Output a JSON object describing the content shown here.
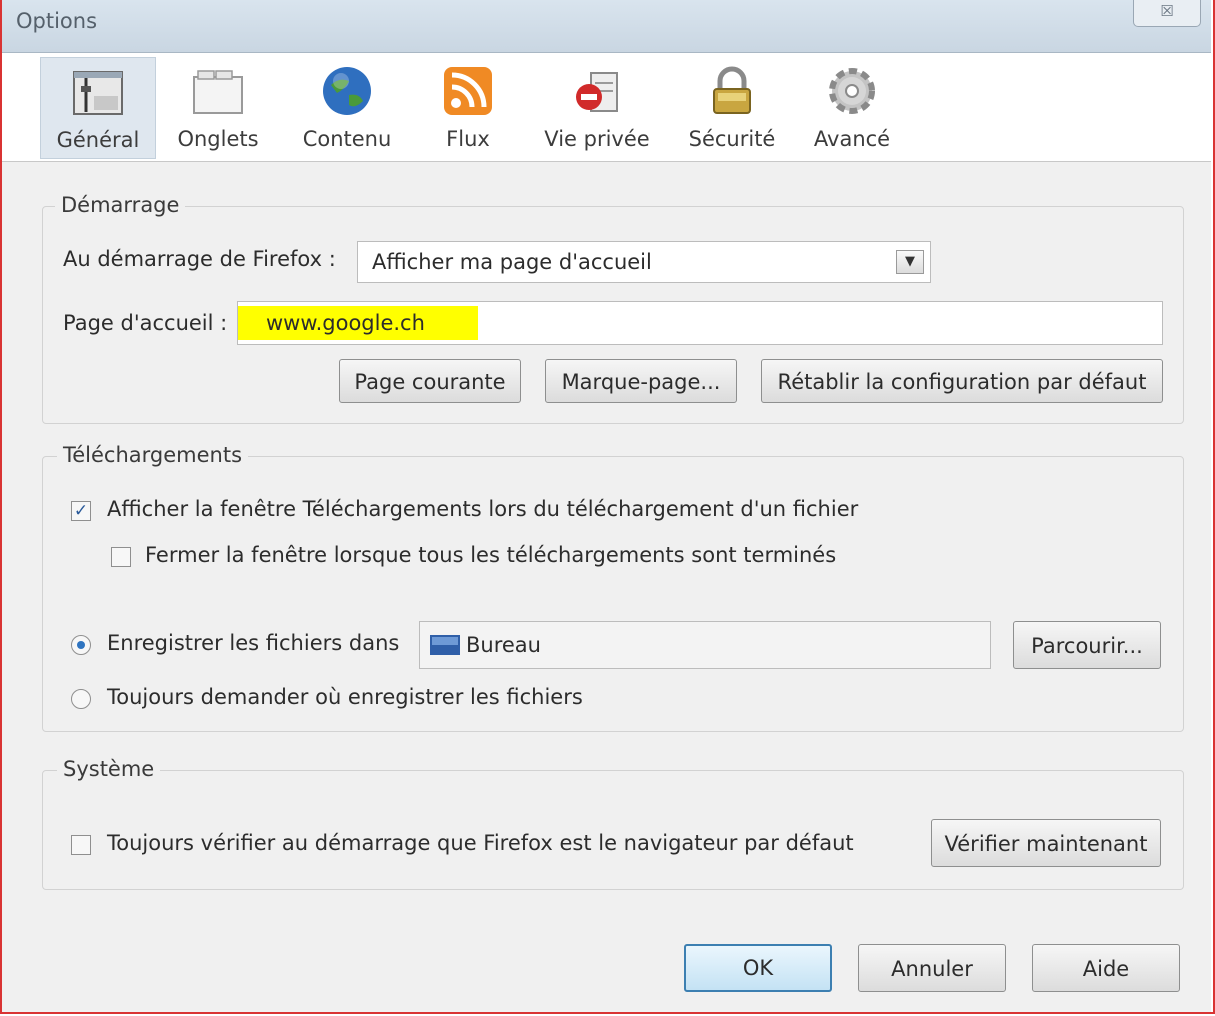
{
  "window": {
    "title": "Options",
    "close_glyph": "☒"
  },
  "toolbar": [
    {
      "label": "Général",
      "icon": "general-icon",
      "selected": true
    },
    {
      "label": "Onglets",
      "icon": "tabs-icon",
      "selected": false
    },
    {
      "label": "Contenu",
      "icon": "content-globe-icon",
      "selected": false
    },
    {
      "label": "Flux",
      "icon": "rss-feed-icon",
      "selected": false
    },
    {
      "label": "Vie privée",
      "icon": "privacy-icon",
      "selected": false
    },
    {
      "label": "Sécurité",
      "icon": "security-lock-icon",
      "selected": false
    },
    {
      "label": "Avancé",
      "icon": "advanced-gear-icon",
      "selected": false
    }
  ],
  "startup": {
    "legend": "Démarrage",
    "on_start_label": "Au démarrage de Firefox :",
    "on_start_value": "Afficher ma page d'accueil",
    "homepage_label": "Page d'accueil :",
    "homepage_value": "www.google.ch",
    "highlight_color": "#ffff00",
    "btn_current": "Page courante",
    "btn_bookmark": "Marque-page...",
    "btn_restore": "Rétablir la configuration par défaut"
  },
  "downloads": {
    "legend": "Téléchargements",
    "show_window_label": "Afficher la fenêtre Téléchargements lors du téléchargement d'un fichier",
    "show_window_checked": true,
    "close_window_label": "Fermer la fenêtre lorsque tous les téléchargements sont terminés",
    "close_window_checked": false,
    "save_in_label": "Enregistrer les fichiers dans",
    "save_in_selected": true,
    "folder_value": "Bureau",
    "browse_label": "Parcourir...",
    "always_ask_label": "Toujours demander où enregistrer les fichiers"
  },
  "system": {
    "legend": "Système",
    "check_default_label": "Toujours vérifier au démarrage que Firefox est le navigateur par défaut",
    "check_default_checked": false,
    "check_now_label": "Vérifier maintenant"
  },
  "footer": {
    "ok": "OK",
    "cancel": "Annuler",
    "help": "Aide"
  },
  "colors": {
    "accent": "#2f74c0",
    "frame_border": "#d93333"
  }
}
